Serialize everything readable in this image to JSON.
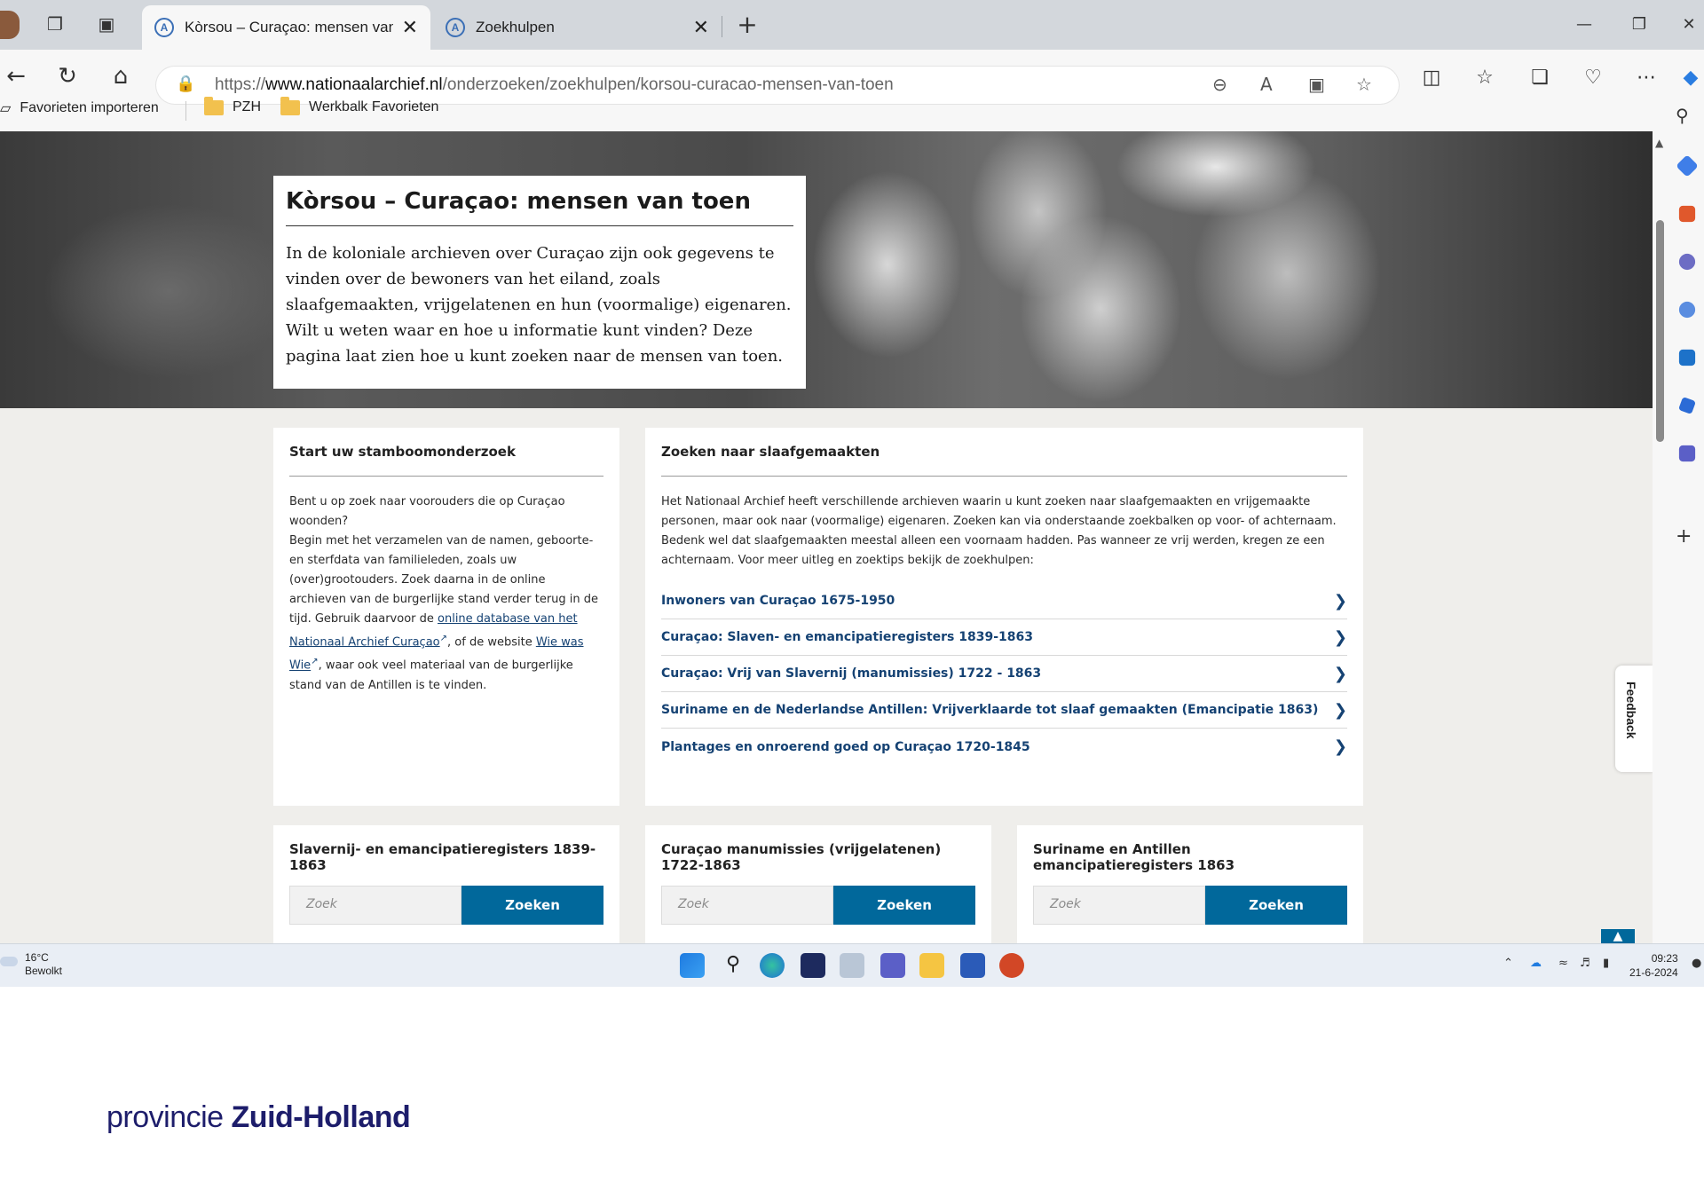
{
  "browser": {
    "tabs": [
      {
        "title": "Kòrsou – Curaçao: mensen van to"
      },
      {
        "title": "Zoekhulpen"
      }
    ],
    "url_prefix": "https://",
    "url_domain": "www.nationaalarchief.nl",
    "url_path": "/onderzoeken/zoekhulpen/korsou-curacao-mensen-van-toen",
    "favorites": [
      {
        "label": "Favorieten importeren"
      },
      {
        "label": "PZH"
      },
      {
        "label": "Werkbalk Favorieten"
      }
    ]
  },
  "hero": {
    "title": "Kòrsou – Curaçao: mensen van toen",
    "intro": "In de koloniale archieven over Curaçao zijn ook gegevens te vinden over de bewoners van het eiland, zoals slaafgemaakten, vrijgelatenen en hun (voormalige) eigenaren. Wilt u weten waar en hoe u informatie kunt vinden? Deze pagina laat zien hoe u kunt zoeken naar de mensen van toen."
  },
  "stamboom": {
    "heading": "Start uw stamboomonderzoek",
    "text_1": "Bent u op zoek naar voorouders die op Curaçao woonden?",
    "text_2": "Begin met het verzamelen van de namen, geboorte- en sterfdata van familieleden, zoals uw (over)grootouders. Zoek daarna in de online archieven van de burgerlijke stand verder terug in de tijd. Gebruik daarvoor de ",
    "link_1": "online database van het Nationaal Archief Curaçao",
    "text_3": ", of de website ",
    "link_2": "Wie was Wie",
    "text_4": ", waar ook veel materiaal van de burgerlijke stand van de Antillen is te vinden."
  },
  "slaafgemaakten": {
    "heading": "Zoeken naar slaafgemaakten",
    "text": "Het Nationaal Archief heeft verschillende archieven waarin u kunt zoeken naar slaafgemaakten en vrijgemaakte personen, maar ook naar (voormalige) eigenaren. Zoeken kan via onderstaande zoekbalken op voor- of achternaam. Bedenk wel dat slaafgemaakten meestal alleen een voornaam hadden. Pas wanneer ze vrij werden, kregen ze een achternaam. Voor meer uitleg en zoektips bekijk de zoekhulpen:",
    "links": [
      {
        "label": "Inwoners van Curaçao 1675-1950"
      },
      {
        "label": "Curaçao: Slaven- en emancipatieregisters 1839-1863"
      },
      {
        "label": "Curaçao: Vrij van Slavernij (manumissies) 1722 - 1863"
      },
      {
        "label": "Suriname en de Nederlandse Antillen: Vrijverklaarde tot slaaf gemaakten (Emancipatie 1863)"
      },
      {
        "label": "Plantages en onroerend goed op Curaçao 1720-1845"
      }
    ]
  },
  "searches": [
    {
      "heading": "Slavernij- en emancipatieregisters 1839-1863",
      "placeholder": "Zoek",
      "button": "Zoeken"
    },
    {
      "heading": "Curaçao manumissies (vrijgelatenen) 1722-1863",
      "placeholder": "Zoek",
      "button": "Zoeken"
    },
    {
      "heading": "Suriname en Antillen emancipatieregisters 1863",
      "placeholder": "Zoek",
      "button": "Zoeken"
    }
  ],
  "feedback": {
    "label": "Feedback"
  },
  "taskbar": {
    "temperature": "16°C",
    "weather": "Bewolkt",
    "time": "09:23",
    "date": "21-6-2024"
  },
  "footer": {
    "logo_light": "provincie",
    "logo_bold": "Zuid-Holland"
  },
  "colors": {
    "accent": "#01689b",
    "link": "#154273",
    "logo": "#1d1d6b"
  }
}
